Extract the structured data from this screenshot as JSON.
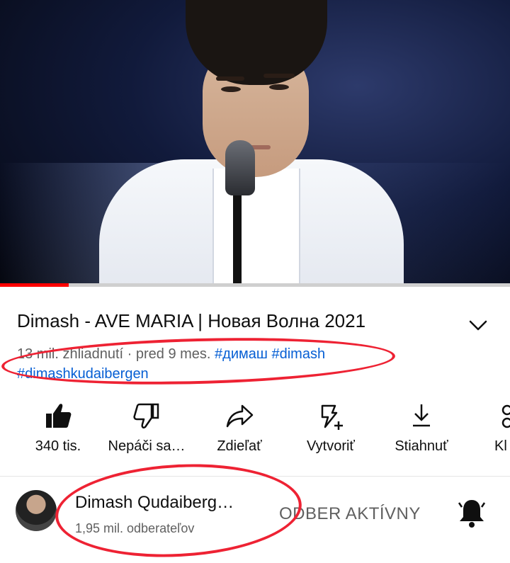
{
  "video": {
    "progress_fraction": 0.135,
    "accent_color": "#ff0000"
  },
  "title": "Dimash - AVE MARIA | Новая Волна 2021",
  "meta": {
    "views": "13 mil. zhliadnutí",
    "separator": " · ",
    "age": "pred 9 mes.",
    "hashtags": [
      "#димаш",
      "#dimash",
      "#dimashkudaibergen"
    ]
  },
  "actions": [
    {
      "label": "340 tis.",
      "icon": "thumb-up-icon"
    },
    {
      "label": "Nepáči sa…",
      "icon": "thumb-down-icon"
    },
    {
      "label": "Zdieľať",
      "icon": "share-icon"
    },
    {
      "label": "Vytvoriť",
      "icon": "create-icon"
    },
    {
      "label": "Stiahnuť",
      "icon": "download-icon"
    },
    {
      "label": "Kl",
      "icon": "clip-icon"
    }
  ],
  "channel": {
    "name": "Dimash Qudaiberg…",
    "subscribers": "1,95 mil. odberateľov",
    "subscribe_label": "ODBER AKTÍVNY"
  },
  "colors": {
    "link": "#065fd4",
    "annotation": "#ee2233",
    "secondary_text": "#606060"
  }
}
